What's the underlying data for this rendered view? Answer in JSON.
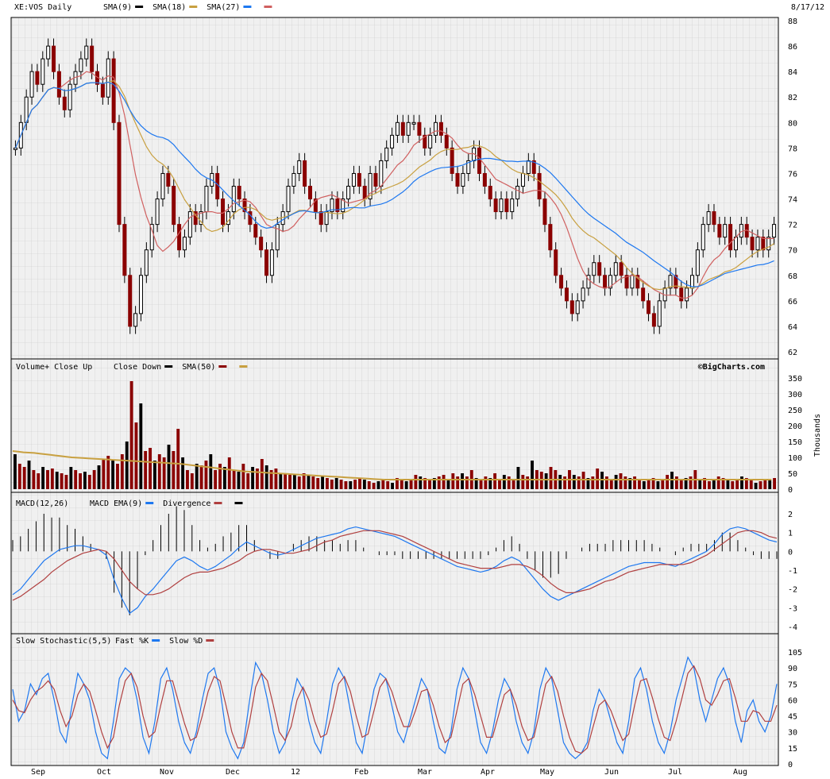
{
  "header": {
    "symbol_label": "XE:VOS Daily",
    "date_label": "8/17/12",
    "legend": [
      {
        "name": "SMA(9)",
        "color": "#000000"
      },
      {
        "name": "SMA(18)",
        "color": "#c8a040"
      },
      {
        "name": "SMA(27)",
        "color": "#1e78f0"
      },
      {
        "name": "",
        "color": "#d06060"
      }
    ]
  },
  "watermark": "©BigCharts.com",
  "x_axis": {
    "months": [
      "Sep",
      "Oct",
      "Nov",
      "Dec",
      "12",
      "Feb",
      "Mar",
      "Apr",
      "May",
      "Jun",
      "Jul",
      "Aug"
    ]
  },
  "chart_data": [
    {
      "type": "candlestick",
      "title": "XE:VOS Daily",
      "ylim": [
        62,
        88
      ],
      "yticks": [
        "62",
        "64",
        "66",
        "68",
        "70",
        "72",
        "74",
        "76",
        "78",
        "80",
        "82",
        "84",
        "86",
        "88"
      ],
      "legend_placement": "top-left",
      "series": [
        {
          "name": "SMA(9)",
          "color": "#000000"
        },
        {
          "name": "SMA(18)",
          "color": "#c8a040"
        },
        {
          "name": "SMA(27)",
          "color": "#1e78f0"
        }
      ],
      "close": [
        78,
        80,
        82,
        84,
        83,
        85,
        86,
        84,
        82,
        81,
        83,
        84,
        85,
        86,
        84,
        83,
        82,
        85,
        80,
        72,
        68,
        64,
        65,
        68,
        70,
        72,
        74,
        76,
        75,
        72,
        70,
        71,
        73,
        72,
        73,
        75,
        76,
        74,
        72,
        73,
        75,
        74,
        73,
        72,
        71,
        70,
        68,
        70,
        72,
        73,
        75,
        76,
        77,
        75,
        74,
        73,
        72,
        73,
        74,
        73,
        74,
        75,
        76,
        75,
        74,
        76,
        75,
        77,
        78,
        79,
        80,
        79,
        80,
        80,
        79,
        78,
        79,
        80,
        79,
        78,
        76,
        75,
        76,
        77,
        78,
        76,
        75,
        74,
        73,
        74,
        73,
        74,
        75,
        76,
        77,
        76,
        74,
        72,
        70,
        68,
        67,
        66,
        65,
        66,
        67,
        68,
        69,
        68,
        67,
        68,
        69,
        68,
        67,
        68,
        67,
        66,
        65,
        64,
        66,
        67,
        68,
        67,
        66,
        67,
        68,
        70,
        72,
        73,
        72,
        71,
        72,
        70,
        71,
        72,
        71,
        70,
        71,
        70,
        71,
        72
      ],
      "annotation": "©BigCharts.com"
    },
    {
      "type": "bar",
      "title": "Volume+ Close Up",
      "legend": [
        {
          "name": "Close Down",
          "color": "#000000"
        },
        {
          "name": "SMA(50)",
          "color": "#8b0000"
        },
        {
          "name": "",
          "color": "#c8a040"
        }
      ],
      "ylabel": "Thousands",
      "ylim": [
        0,
        350
      ],
      "yticks": [
        "0",
        "50",
        "100",
        "150",
        "200",
        "250",
        "300",
        "350"
      ],
      "values": [
        110,
        80,
        70,
        90,
        60,
        50,
        70,
        60,
        65,
        55,
        50,
        45,
        70,
        60,
        50,
        55,
        45,
        60,
        75,
        95,
        105,
        90,
        80,
        110,
        150,
        340,
        210,
        270,
        120,
        130,
        90,
        110,
        100,
        140,
        120,
        190,
        100,
        60,
        50,
        80,
        75,
        90,
        110,
        60,
        80,
        70,
        100,
        60,
        55,
        80,
        50,
        70,
        65,
        95,
        75,
        60,
        65,
        50,
        50,
        45,
        45,
        40,
        50,
        45,
        40,
        35,
        40,
        35,
        30,
        35,
        30,
        25,
        25,
        30,
        35,
        30,
        25,
        20,
        25,
        30,
        25,
        20,
        35,
        30,
        25,
        30,
        45,
        40,
        35,
        30,
        35,
        40,
        45,
        30,
        50,
        40,
        50,
        40,
        60,
        35,
        30,
        40,
        35,
        50,
        30,
        45,
        40,
        30,
        70,
        45,
        40,
        90,
        60,
        55,
        50,
        70,
        60,
        45,
        40,
        60,
        45,
        40,
        55,
        35,
        40,
        65,
        55,
        40,
        30,
        45,
        50,
        40,
        35,
        40,
        30,
        25,
        30,
        35,
        25,
        30,
        45,
        55,
        40,
        30,
        35,
        40,
        60,
        30,
        35,
        25,
        30,
        40,
        35,
        30,
        25,
        30,
        40,
        35,
        30,
        20,
        25,
        30,
        30,
        35
      ],
      "sma50": [
        120,
        118,
        116,
        115,
        114,
        112,
        110,
        108,
        106,
        104,
        102,
        100,
        99,
        98,
        97,
        96,
        95,
        94,
        93,
        92,
        91,
        90,
        89,
        88,
        87,
        86,
        85,
        84,
        83,
        82,
        81,
        80,
        78,
        76,
        74,
        72,
        70,
        68,
        66,
        64,
        62,
        60,
        58,
        56,
        55,
        54,
        53,
        52,
        51,
        50,
        49,
        48,
        47,
        46,
        45,
        44,
        43,
        42,
        41,
        40,
        39,
        38,
        37,
        36,
        35,
        34,
        33,
        32,
        31,
        30,
        30,
        30,
        30,
        30,
        30,
        30,
        30,
        30,
        30,
        30,
        30,
        30,
        30,
        30,
        30,
        30,
        30,
        30,
        30,
        30,
        30,
        30,
        30,
        30,
        30,
        30,
        30,
        30,
        30,
        30,
        30,
        30,
        30,
        30,
        30,
        30,
        30,
        30,
        30,
        30,
        30,
        30,
        30,
        30,
        30,
        30,
        30,
        30,
        30,
        30,
        30,
        30,
        30,
        30,
        30,
        30,
        30,
        30,
        30,
        30,
        30,
        30,
        30,
        30,
        30,
        30,
        30,
        30,
        30,
        30,
        30,
        30
      ]
    },
    {
      "type": "line",
      "title": "MACD(12,26)",
      "legend": [
        {
          "name": "MACD EMA(9)",
          "color": "#1e78f0"
        },
        {
          "name": "Divergence",
          "color": "#b04040"
        },
        {
          "name": "",
          "color": "#000000"
        }
      ],
      "ylim": [
        -4,
        2
      ],
      "yticks": [
        "-4",
        "-3",
        "-2",
        "-1",
        "0",
        "1",
        "2"
      ],
      "macd": [
        -2.3,
        -2.0,
        -1.5,
        -1.0,
        -0.5,
        -0.2,
        0.1,
        0.2,
        0.3,
        0.3,
        0.2,
        0.1,
        -0.2,
        -1.5,
        -2.5,
        -3.3,
        -3.0,
        -2.4,
        -2.0,
        -1.5,
        -1.0,
        -0.5,
        -0.3,
        -0.5,
        -0.8,
        -1.0,
        -0.8,
        -0.5,
        -0.2,
        0.2,
        0.5,
        0.3,
        0.1,
        -0.1,
        -0.2,
        -0.1,
        0.1,
        0.3,
        0.5,
        0.7,
        0.8,
        0.9,
        1.0,
        1.2,
        1.3,
        1.2,
        1.1,
        1.0,
        0.9,
        0.8,
        0.6,
        0.4,
        0.2,
        0,
        -0.2,
        -0.4,
        -0.6,
        -0.8,
        -0.9,
        -1.0,
        -1.1,
        -1.0,
        -0.8,
        -0.5,
        -0.3,
        -0.5,
        -1.0,
        -1.5,
        -2.0,
        -2.4,
        -2.6,
        -2.4,
        -2.2,
        -2.0,
        -1.8,
        -1.6,
        -1.4,
        -1.2,
        -1.0,
        -0.8,
        -0.7,
        -0.6,
        -0.6,
        -0.6,
        -0.7,
        -0.8,
        -0.6,
        -0.4,
        -0.2,
        0,
        0.4,
        0.9,
        1.2,
        1.3,
        1.2,
        1.0,
        0.8,
        0.6,
        0.5
      ],
      "signal": [
        -2.6,
        -2.4,
        -2.1,
        -1.8,
        -1.5,
        -1.1,
        -0.8,
        -0.5,
        -0.3,
        -0.1,
        0,
        0.1,
        0,
        -0.4,
        -1.0,
        -1.6,
        -2.0,
        -2.3,
        -2.3,
        -2.2,
        -2.0,
        -1.7,
        -1.4,
        -1.2,
        -1.1,
        -1.1,
        -1.0,
        -0.9,
        -0.7,
        -0.5,
        -0.2,
        0,
        0.1,
        0.1,
        0,
        -0.1,
        -0.1,
        0,
        0.1,
        0.3,
        0.5,
        0.6,
        0.8,
        0.9,
        1.0,
        1.1,
        1.1,
        1.1,
        1.0,
        0.9,
        0.8,
        0.6,
        0.4,
        0.2,
        0,
        -0.2,
        -0.4,
        -0.6,
        -0.7,
        -0.8,
        -0.9,
        -0.9,
        -0.9,
        -0.8,
        -0.7,
        -0.7,
        -0.8,
        -1.0,
        -1.3,
        -1.7,
        -2.0,
        -2.2,
        -2.2,
        -2.1,
        -2.0,
        -1.8,
        -1.6,
        -1.5,
        -1.3,
        -1.1,
        -1.0,
        -0.9,
        -0.8,
        -0.7,
        -0.7,
        -0.7,
        -0.7,
        -0.6,
        -0.4,
        -0.2,
        0.1,
        0.4,
        0.7,
        1.0,
        1.1,
        1.1,
        1.0,
        0.8,
        0.7
      ]
    },
    {
      "type": "line",
      "title": "Slow Stochastic(5,5)",
      "legend": [
        {
          "name": "Fast %K",
          "color": "#1e78f0"
        },
        {
          "name": "Slow %D",
          "color": "#b04040"
        }
      ],
      "ylim": [
        0,
        105
      ],
      "yticks": [
        "0",
        "15",
        "30",
        "45",
        "60",
        "75",
        "90",
        "105"
      ],
      "fast_k": [
        70,
        40,
        50,
        75,
        65,
        80,
        85,
        60,
        30,
        20,
        55,
        85,
        75,
        60,
        30,
        10,
        5,
        40,
        80,
        90,
        85,
        60,
        25,
        10,
        40,
        80,
        90,
        70,
        40,
        20,
        10,
        30,
        60,
        85,
        90,
        70,
        30,
        15,
        5,
        20,
        60,
        95,
        85,
        60,
        30,
        10,
        20,
        55,
        80,
        70,
        40,
        20,
        10,
        40,
        75,
        90,
        80,
        50,
        20,
        10,
        40,
        70,
        85,
        80,
        55,
        30,
        20,
        40,
        60,
        80,
        70,
        40,
        15,
        10,
        30,
        70,
        90,
        80,
        50,
        20,
        10,
        30,
        60,
        80,
        70,
        40,
        20,
        10,
        30,
        70,
        90,
        80,
        50,
        20,
        10,
        5,
        10,
        20,
        50,
        70,
        60,
        40,
        20,
        10,
        40,
        80,
        90,
        70,
        40,
        20,
        10,
        30,
        60,
        80,
        100,
        90,
        60,
        40,
        60,
        80,
        90,
        75,
        40,
        20,
        50,
        60,
        40,
        30,
        45,
        75
      ],
      "slow_d": [
        60,
        50,
        48,
        60,
        68,
        72,
        78,
        70,
        50,
        35,
        45,
        65,
        75,
        68,
        50,
        30,
        15,
        25,
        55,
        78,
        85,
        72,
        45,
        25,
        30,
        55,
        78,
        78,
        58,
        38,
        22,
        25,
        45,
        68,
        82,
        78,
        55,
        30,
        15,
        15,
        40,
        72,
        85,
        78,
        55,
        30,
        22,
        35,
        60,
        72,
        60,
        40,
        25,
        28,
        50,
        75,
        82,
        68,
        45,
        25,
        28,
        50,
        72,
        80,
        68,
        50,
        35,
        35,
        50,
        68,
        70,
        55,
        35,
        20,
        25,
        50,
        75,
        80,
        65,
        45,
        25,
        25,
        45,
        65,
        70,
        55,
        35,
        22,
        25,
        50,
        75,
        82,
        68,
        45,
        25,
        12,
        10,
        15,
        35,
        55,
        60,
        50,
        35,
        22,
        28,
        55,
        78,
        80,
        62,
        42,
        25,
        22,
        40,
        62,
        85,
        92,
        80,
        60,
        55,
        65,
        78,
        80,
        62,
        40,
        40,
        50,
        48,
        40,
        40,
        55
      ]
    }
  ]
}
